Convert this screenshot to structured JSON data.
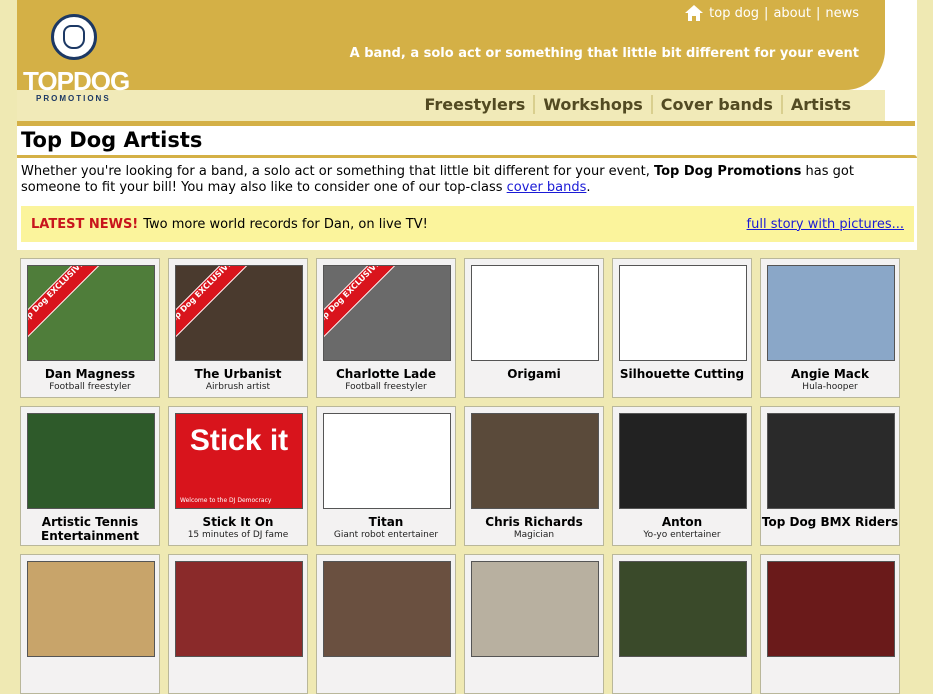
{
  "header": {
    "logo": {
      "top": "TOP",
      "bottom": "DOG",
      "sub": "PROMOTIONS"
    },
    "toplinks": [
      "top dog",
      "about",
      "news"
    ],
    "separator": "|",
    "tagline": "A band, a solo act or something that little bit different for your event",
    "nav": [
      "Freestylers",
      "Workshops",
      "Cover bands",
      "Artists"
    ]
  },
  "main": {
    "title": "Top Dog Artists",
    "intro": {
      "part1": "Whether you're looking for a band, a solo act or something that little bit different for your event, ",
      "bold": "Top Dog Promotions",
      "part2": " has got someone to fit your bill! You may also like to consider one of our top-class ",
      "link": "cover bands",
      "part3": "."
    },
    "news": {
      "label": "LATEST NEWS!",
      "text": "Two more world records for Dan, on live TV!",
      "link": "full story with pictures..."
    }
  },
  "artists": [
    {
      "name": "Dan Magness",
      "sub": "Football freestyler",
      "ribbon": "Top Dog EXCLUSIVE",
      "color": "#4f7d3a"
    },
    {
      "name": "The Urbanist",
      "sub": "Airbrush artist",
      "ribbon": "Top Dog EXCLUSIVE",
      "color": "#4a3a2e"
    },
    {
      "name": "Charlotte Lade",
      "sub": "Football freestyler",
      "ribbon": "Top Dog EXCLUSIVE",
      "color": "#6a6a6a"
    },
    {
      "name": "Origami",
      "sub": "",
      "ribbon": "",
      "color": "#ffffff"
    },
    {
      "name": "Silhouette Cutting",
      "sub": "",
      "ribbon": "",
      "color": "#ffffff"
    },
    {
      "name": "Angie Mack",
      "sub": "Hula-hooper",
      "ribbon": "",
      "color": "#8aa7c8"
    },
    {
      "name": "Artistic Tennis Entertainment",
      "sub": "",
      "ribbon": "",
      "color": "#2e5a2a"
    },
    {
      "name": "Stick It On",
      "sub": "15 minutes of DJ fame",
      "ribbon": "",
      "color": "#d8141c",
      "logo": "Stick it",
      "caption": "Welcome to the DJ Democracy"
    },
    {
      "name": "Titan",
      "sub": "Giant robot entertainer",
      "ribbon": "",
      "color": "#ffffff"
    },
    {
      "name": "Chris Richards",
      "sub": "Magician",
      "ribbon": "",
      "color": "#5a4a3a"
    },
    {
      "name": "Anton",
      "sub": "Yo-yo entertainer",
      "ribbon": "",
      "color": "#222222"
    },
    {
      "name": "Top Dog BMX Riders",
      "sub": "",
      "ribbon": "",
      "color": "#2a2a2a"
    },
    {
      "name": "",
      "sub": "",
      "ribbon": "",
      "color": "#c8a46a"
    },
    {
      "name": "",
      "sub": "",
      "ribbon": "",
      "color": "#8a2a2a"
    },
    {
      "name": "",
      "sub": "",
      "ribbon": "",
      "color": "#6a5040"
    },
    {
      "name": "",
      "sub": "",
      "ribbon": "",
      "color": "#b8b0a0"
    },
    {
      "name": "",
      "sub": "",
      "ribbon": "",
      "color": "#3a4a2a"
    },
    {
      "name": "",
      "sub": "",
      "ribbon": "",
      "color": "#6a1a1a"
    }
  ]
}
